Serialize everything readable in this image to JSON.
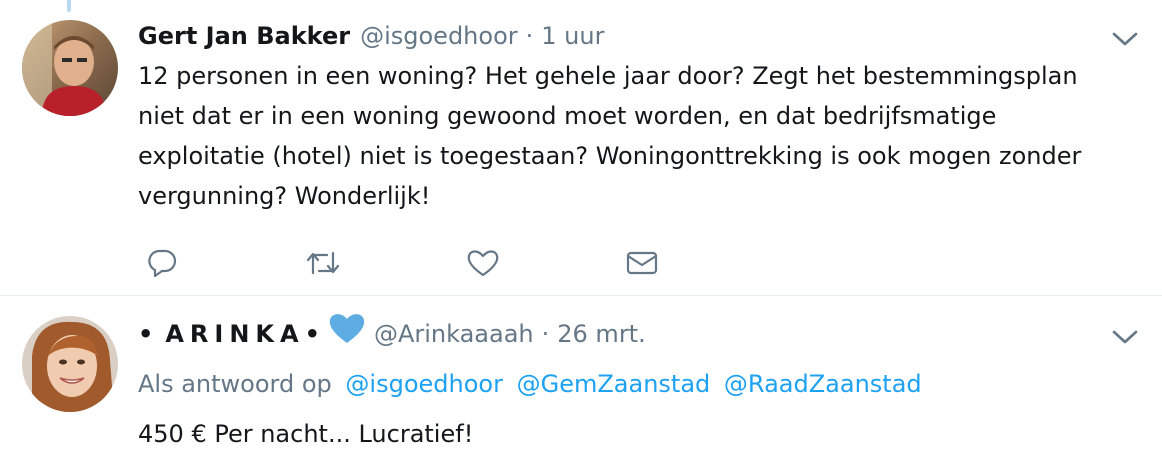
{
  "tweets": [
    {
      "name": "Gert Jan Bakker",
      "handle": "@isgoedhoor",
      "separator": "·",
      "time": "1 uur",
      "text": "12 personen in een woning? Het gehele jaar door? Zegt het bestemmingsplan niet dat er in een woning gewoond moet worden, en dat bedrijfsmatige exploitatie (hotel) niet is toegestaan? Woningonttrekking is ook mogen zonder vergunning? Wonderlijk!",
      "actions": [
        "reply-icon",
        "retweet-icon",
        "like-icon",
        "direct-message-icon"
      ]
    },
    {
      "name_prefix": "•",
      "name": "ARINKA",
      "name_suffix": "•",
      "handle": "@Arinkaaaah",
      "separator": "·",
      "time": "26 mrt.",
      "reply_label": "Als antwoord op",
      "mentions": [
        "@isgoedhoor",
        "@GemZaanstad",
        "@RaadZaanstad"
      ],
      "text": "450 € Per nacht... Lucratief!"
    }
  ],
  "colors": {
    "accent": "#1da1f2",
    "muted": "#657786",
    "icon": "#657786",
    "heart_emoji": "#5dade2",
    "divider": "#e6ecf0"
  }
}
